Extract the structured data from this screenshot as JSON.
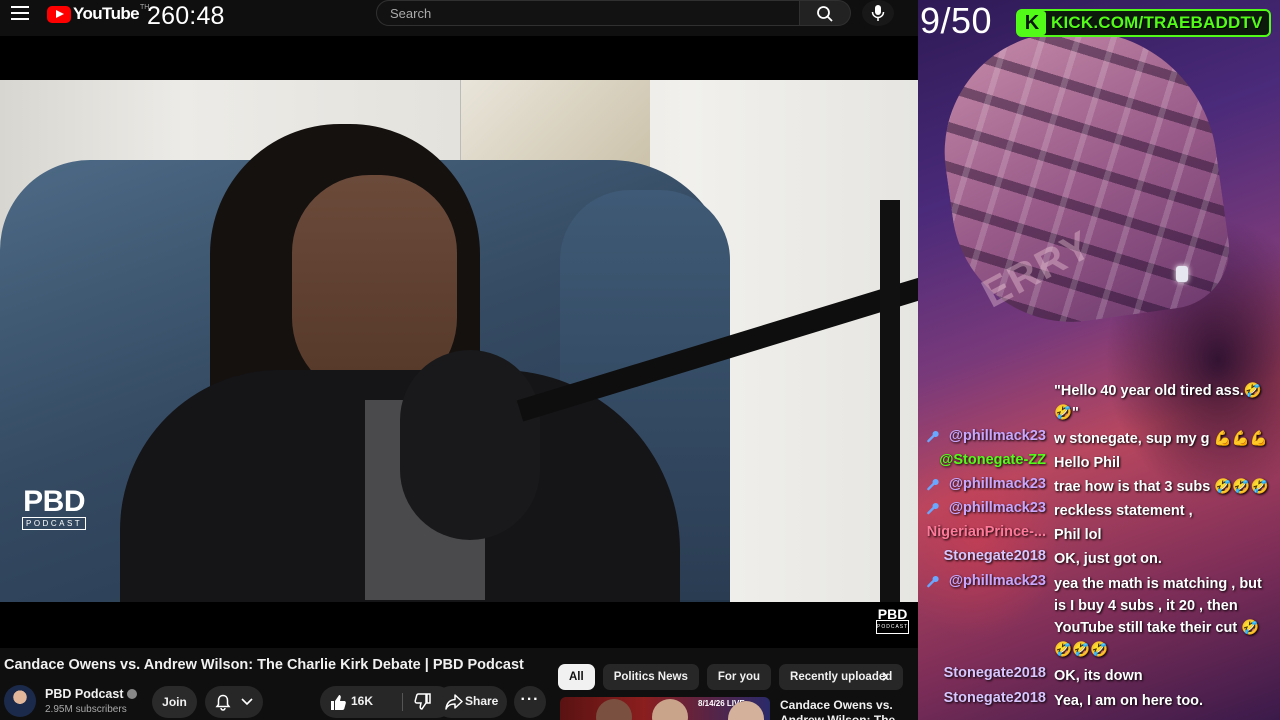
{
  "youtube": {
    "logo_text": "YouTube",
    "logo_sup": "TH",
    "timer": "260:48",
    "search_placeholder": "Search",
    "video_title": "Candace Owens vs. Andrew Wilson: The Charlie Kirk Debate | PBD Podcast",
    "watermark_big": "PBD",
    "watermark_small": "PODCAST",
    "channel": {
      "name": "PBD Podcast",
      "subscribers": "2.95M subscribers"
    },
    "actions": {
      "join": "Join",
      "likes": "16K",
      "share": "Share"
    },
    "chips": [
      "All",
      "Politics News",
      "For you",
      "Recently uploaded"
    ],
    "recommended": {
      "title": "Candace Owens vs. Andrew Wilson: The",
      "badge": "8/14/26 LIVE"
    }
  },
  "stream": {
    "counter": "9/50",
    "kick_url": "KICK.COM/TRAEBADDTV",
    "kick_logo": "K",
    "cap_text": "ERRY"
  },
  "chat": [
    {
      "user": "",
      "text": "\"Hello 40 year old tired ass.🤣🤣\"",
      "mod": false,
      "color": "#ffffff"
    },
    {
      "user": "@phillmack23",
      "text": "w stonegate, sup my g 💪💪💪",
      "mod": true,
      "color": "#c9a7ff"
    },
    {
      "user": "@Stonegate-ZZ",
      "text": "Hello Phil",
      "mod": false,
      "color": "#53fc18"
    },
    {
      "user": "@phillmack23",
      "text": "trae how is that 3 subs 🤣🤣🤣",
      "mod": true,
      "color": "#c9a7ff"
    },
    {
      "user": "@phillmack23",
      "text": "reckless statement ,",
      "mod": true,
      "color": "#c9a7ff"
    },
    {
      "user": "NigerianPrince-...",
      "text": "Phil lol",
      "mod": false,
      "color": "#ff7a9a"
    },
    {
      "user": "Stonegate2018",
      "text": "OK, just got on.",
      "mod": false,
      "color": "#d8c6ff"
    },
    {
      "user": "@phillmack23",
      "text": "yea the math is matching , but is I buy 4 subs , it 20 , then YouTube still take their cut 🤣🤣🤣🤣",
      "mod": true,
      "color": "#c9a7ff"
    },
    {
      "user": "Stonegate2018",
      "text": "OK, its down",
      "mod": false,
      "color": "#d8c6ff"
    },
    {
      "user": "Stonegate2018",
      "text": "Yea, I am on here too.",
      "mod": false,
      "color": "#d8c6ff"
    }
  ]
}
